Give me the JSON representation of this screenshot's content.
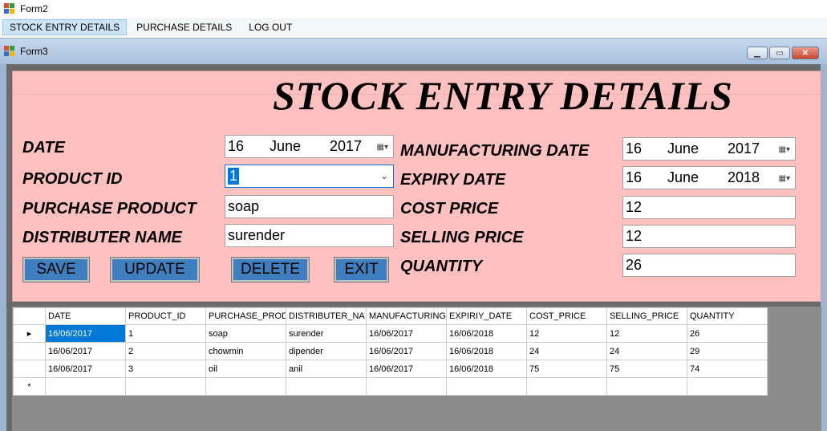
{
  "window": {
    "title": "Form2"
  },
  "menu": {
    "items": [
      {
        "label": "STOCK ENTRY DETAILS"
      },
      {
        "label": "PURCHASE DETAILS"
      },
      {
        "label": "LOG OUT"
      }
    ]
  },
  "child_window": {
    "title": "Form3"
  },
  "form": {
    "heading": "STOCK ENTRY DETAILS",
    "date_label": "DATE",
    "date": {
      "day": "16",
      "month": "June",
      "year": "2017"
    },
    "product_id_label": "PRODUCT ID",
    "product_id": "1",
    "purchase_product_label": "PURCHASE PRODUCT",
    "purchase_product": "soap",
    "distributer_name_label": "DISTRIBUTER NAME",
    "distributer_name": "surender",
    "manufacturing_date_label": "MANUFACTURING DATE",
    "manufacturing_date": {
      "day": "16",
      "month": "June",
      "year": "2017"
    },
    "expiry_date_label": "EXPIRY DATE",
    "expiry_date": {
      "day": "16",
      "month": "June",
      "year": "2018"
    },
    "cost_price_label": "COST PRICE",
    "cost_price": "12",
    "selling_price_label": "SELLING PRICE",
    "selling_price": "12",
    "quantity_label": "QUANTITY",
    "quantity": "26",
    "buttons": {
      "save": "SAVE",
      "update": "UPDATE",
      "delete": "DELETE",
      "exit": "EXIT"
    }
  },
  "grid": {
    "columns": [
      "DATE",
      "PRODUCT_ID",
      "PURCHASE_PROD",
      "DISTRIBUTER_NA",
      "MANUFACTURING",
      "EXPIRIY_DATE",
      "COST_PRICE",
      "SELLING_PRICE",
      "QUANTITY"
    ],
    "rows": [
      [
        "16/06/2017",
        "1",
        "soap",
        "surender",
        "16/06/2017",
        "16/06/2018",
        "12",
        "12",
        "26"
      ],
      [
        "16/06/2017",
        "2",
        "chowmin",
        "dipender",
        "16/06/2017",
        "16/06/2018",
        "24",
        "24",
        "29"
      ],
      [
        "16/06/2017",
        "3",
        "oil",
        "anil",
        "16/06/2017",
        "16/06/2018",
        "75",
        "75",
        "74"
      ]
    ],
    "current_row_marker": "▸",
    "new_row_marker": "*"
  },
  "colors": {
    "panel": "#ffc0c0",
    "button": "#3f7fbf",
    "mdi_background": "#9cb4d0",
    "selection": "#0078d7"
  }
}
